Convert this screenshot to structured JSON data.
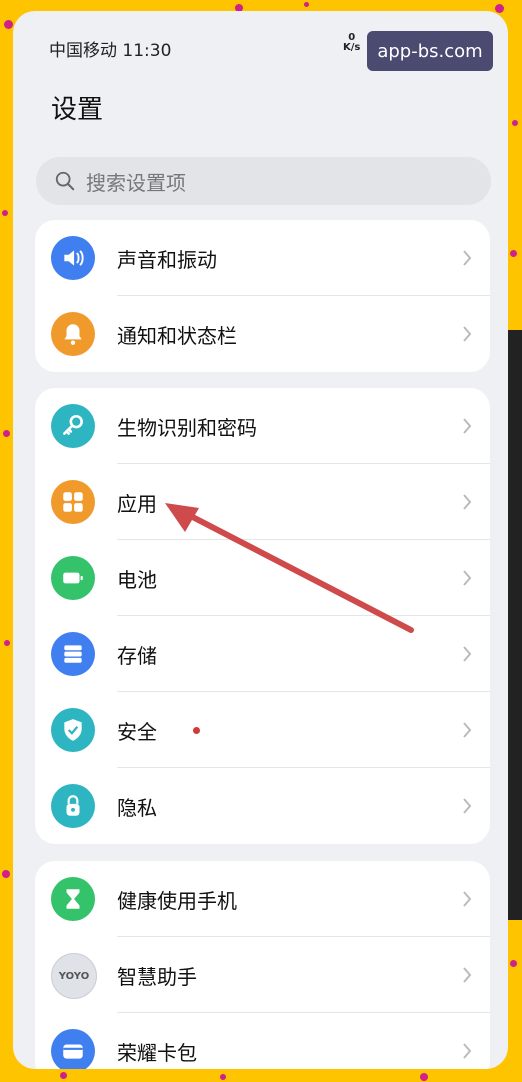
{
  "status": {
    "carrier_time": "中国移动 11:30",
    "speed_top": "0",
    "speed_unit": "K/s"
  },
  "watermark": "app-bs.com",
  "page_title": "设置",
  "search": {
    "placeholder": "搜索设置项"
  },
  "groups": [
    {
      "items": [
        {
          "label": "声音和振动",
          "icon": "speaker-icon",
          "color": "#3f7ff0"
        },
        {
          "label": "通知和状态栏",
          "icon": "bell-icon",
          "color": "#f19a2c"
        }
      ]
    },
    {
      "items": [
        {
          "label": "生物识别和密码",
          "icon": "key-icon",
          "color": "#2db5c2"
        },
        {
          "label": "应用",
          "icon": "apps-grid-icon",
          "color": "#f19a2c"
        },
        {
          "label": "电池",
          "icon": "battery-icon",
          "color": "#34c26b"
        },
        {
          "label": "存储",
          "icon": "storage-icon",
          "color": "#3f7ff0"
        },
        {
          "label": "安全",
          "icon": "shield-icon",
          "color": "#2db5c2",
          "badge": "red-dot"
        },
        {
          "label": "隐私",
          "icon": "privacy-lock-icon",
          "color": "#2db5c2"
        }
      ]
    },
    {
      "items": [
        {
          "label": "健康使用手机",
          "icon": "hourglass-icon",
          "color": "#34c26b"
        },
        {
          "label": "智慧助手",
          "icon": "yoyo-icon",
          "color": "#dfe3e8",
          "icon_text": "YOYO"
        },
        {
          "label": "荣耀卡包",
          "icon": "wallet-icon",
          "color": "#3f7ff0"
        }
      ]
    }
  ],
  "colors": {
    "background": "#ffc400",
    "dots": "#d0208a",
    "arrow": "#cf4a4a"
  }
}
